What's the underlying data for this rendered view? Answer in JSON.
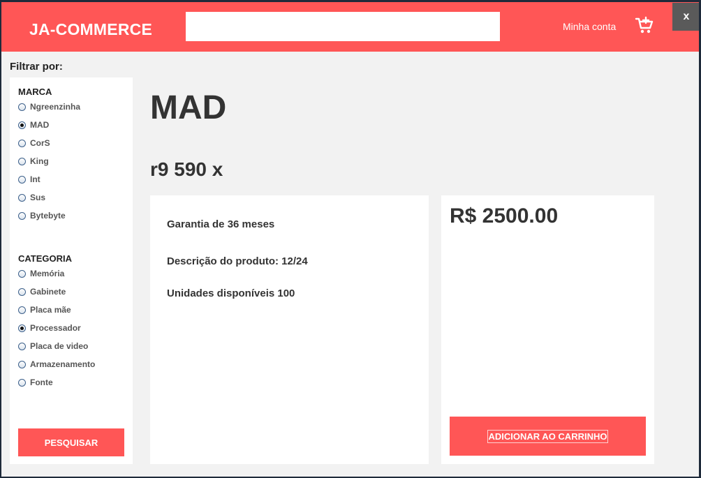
{
  "header": {
    "logo": "JA-COMMERCE",
    "search_value": "",
    "account_label": "Minha conta",
    "cart_icon": "cart-plus-icon",
    "close_label": "x"
  },
  "filters": {
    "title": "Filtrar por:",
    "brand": {
      "title": "MARCA",
      "options": [
        "Ngreenzinha",
        "MAD",
        "CorS",
        "King",
        "Int",
        "Sus",
        "Bytebyte"
      ],
      "selected": "MAD"
    },
    "category": {
      "title": "CATEGORIA",
      "options": [
        "Memória",
        "Gabinete",
        "Placa mãe",
        "Processador",
        "Placa de video",
        "Armazenamento",
        "Fonte"
      ],
      "selected": "Processador"
    },
    "search_button": "PESQUISAR"
  },
  "product": {
    "brand": "MAD",
    "model": "r9 590 x",
    "warranty": "Garantia de 36 meses",
    "description": "Descrição do produto: 12/24",
    "stock": "Unidades disponíveis 100",
    "price": "R$ 2500.00",
    "add_to_cart": "ADICIONAR AO CARRINHO"
  },
  "colors": {
    "accent": "#ff5656",
    "background": "#f2f2f2",
    "close_button": "#5a5a5a"
  }
}
